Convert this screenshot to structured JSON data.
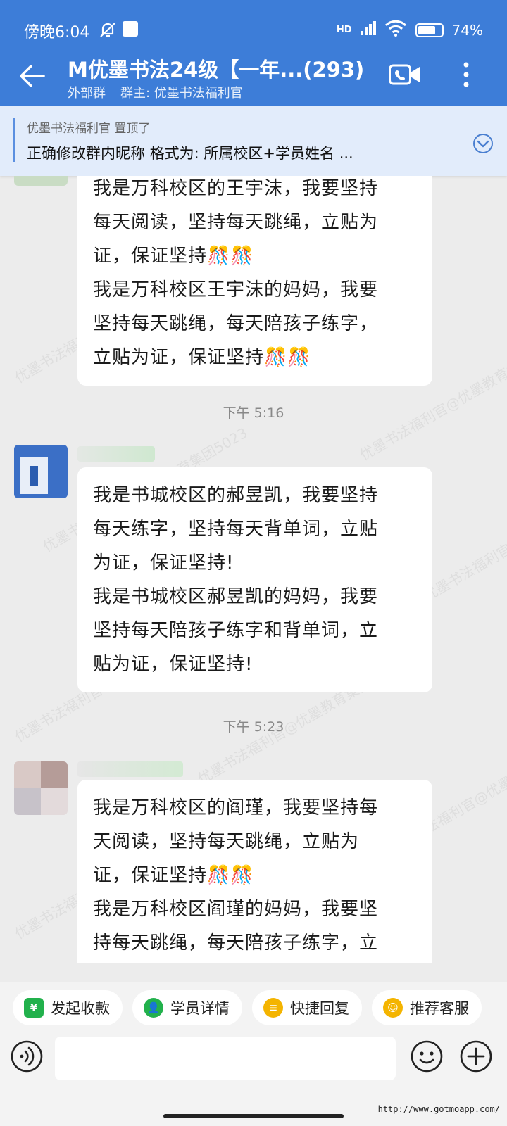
{
  "status": {
    "time": "傍晚6:04",
    "network": "HD",
    "battery": "74%",
    "battery_level": 0.74
  },
  "header": {
    "title": "M优墨书法24级【一年...(293)",
    "group_type": "外部群",
    "owner": "群主: 优墨书法福利官"
  },
  "pinned": {
    "by": "优墨书法福利官 置顶了",
    "text": "正确修改群内昵称 格式为: 所属校区+学员姓名 ..."
  },
  "watermark": "优墨书法福利官@优墨教育集团5023",
  "messages": [
    {
      "lines": [
        "我是万科校区的王宇沫，我要坚持",
        "每天阅读，坚持每天跳绳，立贴为",
        "证，保证坚持🎊🎊",
        "我是万科校区王宇沫的妈妈，我要",
        "坚持每天跳绳，每天陪孩子练字，",
        "立贴为证，保证坚持🎊🎊"
      ]
    },
    {
      "time": "下午 5:16",
      "lines": [
        "我是书城校区的郝昱凯，我要坚持",
        "每天练字，坚持每天背单词，立贴",
        "为证，保证坚持!",
        "我是书城校区郝昱凯的妈妈，我要",
        "坚持每天陪孩子练字和背单词，立",
        "贴为证，保证坚持!"
      ]
    },
    {
      "time": "下午 5:23",
      "lines": [
        "我是万科校区的阎瑾，我要坚持每",
        "天阅读，坚持每天跳绳，立贴为",
        "证，保证坚持🎊🎊",
        "我是万科校区阎瑾的妈妈，我要坚",
        "持每天跳绳，每天陪孩子练字，立"
      ]
    }
  ],
  "quick_actions": [
    {
      "label": "发起收款",
      "icon": "yen-icon",
      "color": "#22b14c"
    },
    {
      "label": "学员详情",
      "icon": "student-icon",
      "color": "#22b14c"
    },
    {
      "label": "快捷回复",
      "icon": "quick-reply-icon",
      "color": "#f4b400"
    },
    {
      "label": "推荐客服",
      "icon": "service-icon",
      "color": "#f4b400"
    }
  ],
  "footer": {
    "site": "http://www.gotmoapp.com/"
  },
  "colors": {
    "header_bg": "#3d7dd8",
    "pinned_bg": "#e2ecfb",
    "chat_bg": "#ececec"
  }
}
